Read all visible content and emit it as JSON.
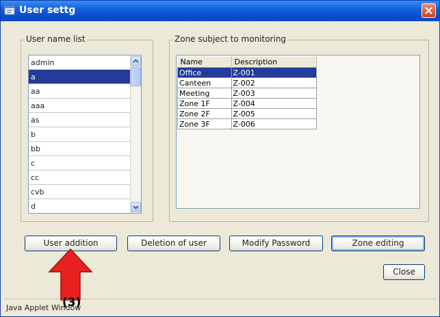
{
  "window": {
    "title": "User settg"
  },
  "user_list": {
    "label": "User name list",
    "items": [
      "admin",
      "a",
      "aa",
      "aaa",
      "as",
      "b",
      "bb",
      "c",
      "cc",
      "cvb",
      "d"
    ],
    "selected_index": 1
  },
  "zone_list": {
    "label": "Zone subject to monitoring",
    "columns": [
      "Name",
      "Description"
    ],
    "rows": [
      {
        "name": "Office",
        "description": "Z-001"
      },
      {
        "name": "Canteen",
        "description": "Z-002"
      },
      {
        "name": "Meeting",
        "description": "Z-003"
      },
      {
        "name": "Zone 1F",
        "description": "Z-004"
      },
      {
        "name": "Zone 2F",
        "description": "Z-005"
      },
      {
        "name": "Zone 3F",
        "description": "Z-006"
      }
    ],
    "selected_index": 0
  },
  "buttons": {
    "user_addition": "User addition",
    "deletion_of_user": "Deletion of user",
    "modify_password": "Modify Password",
    "zone_editing": "Zone editing",
    "close": "Close"
  },
  "status": {
    "text": "Java Applet Window"
  },
  "annotation": {
    "label": "(3)",
    "arrow_color": "#e8201f"
  }
}
